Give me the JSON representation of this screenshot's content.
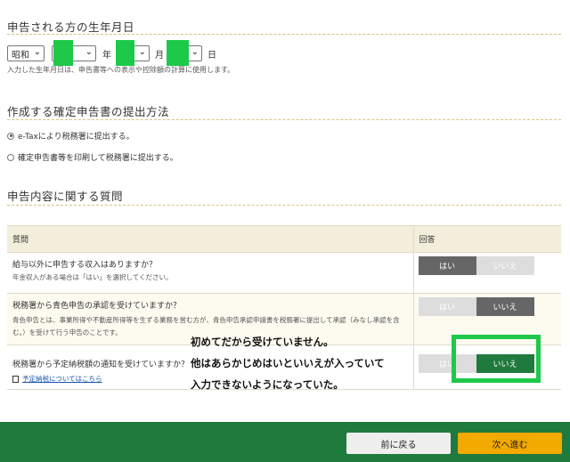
{
  "birth": {
    "title": "申告される方の生年月日",
    "era": "昭和",
    "year_unit": "年",
    "month_unit": "月",
    "day_unit": "日",
    "note": "入力した生年月日は、申告書等への表示や控除額の計算に使用します。"
  },
  "submission": {
    "title": "作成する確定申告書の提出方法",
    "options": [
      {
        "label": "e-Taxにより税務署に提出する。",
        "selected": true
      },
      {
        "label": "確定申告書等を印刷して税務署に提出する。",
        "selected": false
      }
    ]
  },
  "questions": {
    "title": "申告内容に関する質問",
    "header_question": "質問",
    "header_answer": "回答",
    "yes": "はい",
    "no": "いいえ",
    "rows": [
      {
        "question": "給与以外に申告する収入はありますか？",
        "sub": "年金収入がある場合は「はい」を選択してください。",
        "answer": "yes"
      },
      {
        "question": "税務署から青色申告の承認を受けていますか？",
        "sub": "青色申告とは、事業所得や不動産所得等を生ずる業務を営む方が、青色申告承認申請書を税務署に提出して承認（みなし承認を含む。）を受けて行う申告のことです。",
        "answer": "no"
      },
      {
        "question": "税務署から予定納税額の通知を受けていますか？",
        "link": "予定納税についてはこちら",
        "answer": "no"
      }
    ]
  },
  "annotation": {
    "line1": "初めてだから受けていません。",
    "line2": "他はあらかじめはいといいえが入っていて",
    "line3": "入力できないようになっていた。"
  },
  "footer": {
    "back": "前に戻る",
    "next": "次へ進む"
  },
  "colors": {
    "green": "#1f7a3d",
    "highlight": "#1ec94a",
    "next": "#f2a900"
  }
}
